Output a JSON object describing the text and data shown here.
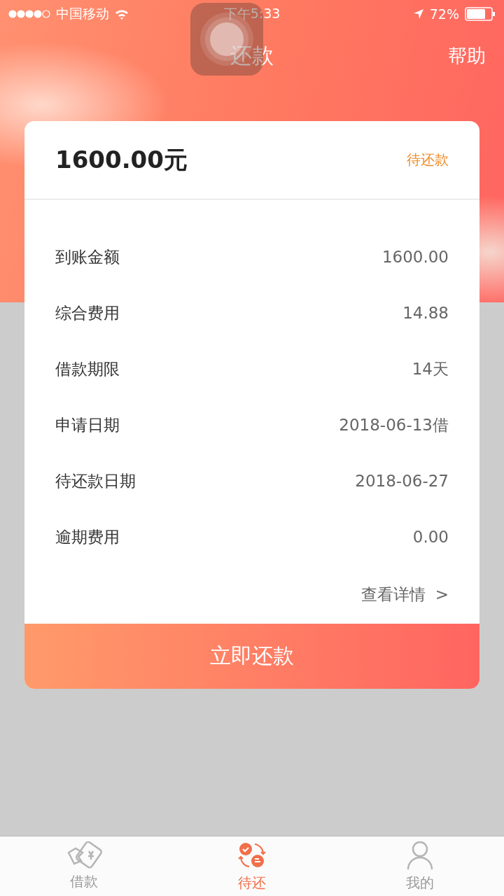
{
  "status_bar": {
    "carrier": "中国移动",
    "time": "下午5:33",
    "battery": "72%"
  },
  "nav": {
    "title": "还款",
    "action": "帮助"
  },
  "loan": {
    "amount": "1600.00元",
    "status": "待还款",
    "rows": [
      {
        "label": "到账金额",
        "value": "1600.00"
      },
      {
        "label": "综合费用",
        "value": "14.88"
      },
      {
        "label": "借款期限",
        "value": "14天"
      },
      {
        "label": "申请日期",
        "value": "2018-06-13借"
      },
      {
        "label": "待还款日期",
        "value": "2018-06-27"
      },
      {
        "label": "逾期费用",
        "value": "0.00"
      }
    ],
    "details_link": "查看详情",
    "details_arrow": ">",
    "button": "立即还款"
  },
  "tabs": [
    {
      "label": "借款",
      "selected": false
    },
    {
      "label": "待还",
      "selected": true
    },
    {
      "label": "我的",
      "selected": false
    }
  ]
}
